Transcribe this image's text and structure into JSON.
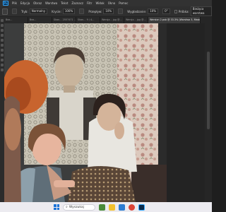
{
  "app": {
    "logo_text": "Ps"
  },
  "menu": [
    "Plik",
    "Edycja",
    "Obraz",
    "Warstwa",
    "Tekst",
    "Zaznacz",
    "Filtr",
    "Widok",
    "Okno",
    "Pomoc"
  ],
  "options": {
    "mode_label": "Tryb:",
    "mode_value": "Normalny",
    "opacity_label": "Krycie:",
    "opacity_value": "100%",
    "flow_label": "Przepływ:",
    "flow_value": "10%",
    "smoothing_label": "Wygładzanie:",
    "smoothing_value": "10%",
    "angle_value": "0°",
    "sample_label": "Próbka:",
    "sample_value": "Bieżąca warstwa"
  },
  "tabs": [
    {
      "label": "Bez..."
    },
    {
      "label": "Bez..."
    },
    {
      "label": "Skan... 2557471 ..."
    },
    {
      "label": "Skan... 9 / 4..."
    },
    {
      "label": "Wersja... jpg @..."
    },
    {
      "label": "Wersja... jpg @..."
    },
    {
      "label": "Wersion 2.psb @ 33.3% (Warstwa 3, Maska warstwy/8) *",
      "active": true
    }
  ],
  "taskbar": {
    "search_placeholder": "Wyszukaj",
    "apps": [
      {
        "name": "landscape-app-icon",
        "color": "#4a8b3a"
      },
      {
        "name": "file-explorer-icon",
        "color": "#f2c12e"
      },
      {
        "name": "mail-icon",
        "color": "#2d7dd2"
      },
      {
        "name": "chrome-icon",
        "color": "#db4437"
      },
      {
        "name": "photoshop-icon",
        "color": "#0b2a4a"
      }
    ]
  }
}
